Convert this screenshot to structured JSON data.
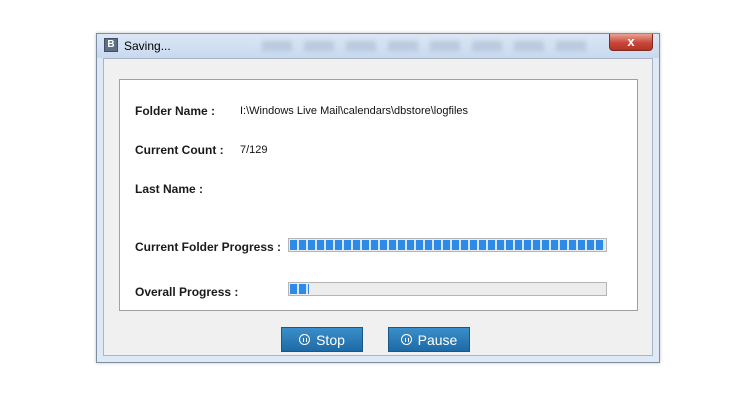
{
  "window": {
    "icon_letter": "B",
    "title": "Saving...",
    "close_glyph": "x"
  },
  "fields": {
    "folder_name_label": "Folder Name :",
    "folder_name_value": "I:\\Windows Live Mail\\calendars\\dbstore\\logfiles",
    "current_count_label": "Current Count :",
    "current_count_value": "7/129",
    "last_name_label": "Last Name :",
    "last_name_value": ""
  },
  "progress": {
    "current_folder_label": "Current Folder Progress :",
    "current_folder_fraction": 1.0,
    "overall_label": "Overall Progress :",
    "overall_fraction": 0.06
  },
  "buttons": {
    "stop_label": "Stop",
    "pause_label": "Pause"
  },
  "colors": {
    "progress_fill": "#2d8ae6",
    "button_bg": "#1d6aa6",
    "close_button": "#c8473a"
  },
  "icons": {
    "app": "app-logo-icon",
    "close": "close-icon",
    "stop": "pause-circle-icon",
    "pause": "pause-circle-icon"
  }
}
